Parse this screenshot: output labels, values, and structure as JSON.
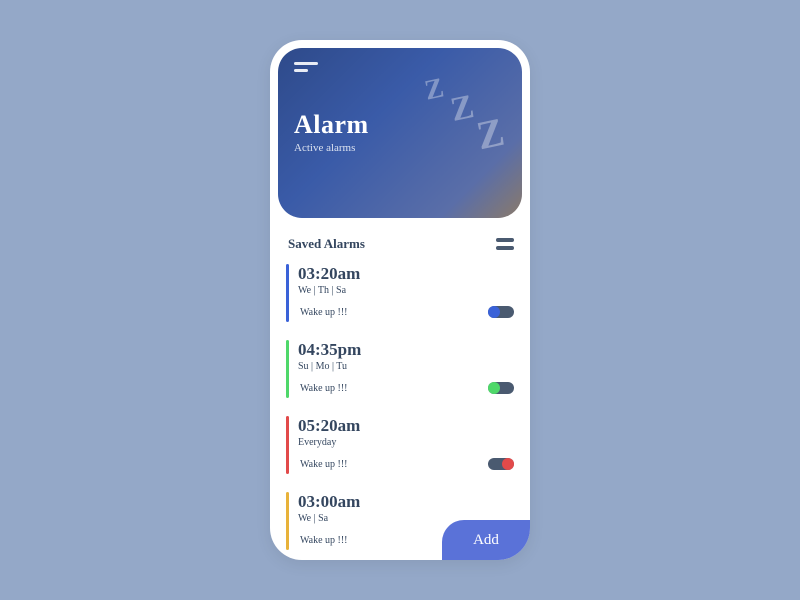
{
  "hero": {
    "title": "Alarm",
    "subtitle": "Active alarms"
  },
  "list": {
    "title": "Saved Alarms"
  },
  "alarms": [
    {
      "time": "03:20am",
      "days": "We | Th | Sa",
      "label": "Wake up !!!",
      "accent": "#3a62d8",
      "on": true
    },
    {
      "time": "04:35pm",
      "days": "Su | Mo | Tu",
      "label": "Wake up !!!",
      "accent": "#4fd86a",
      "on": true
    },
    {
      "time": "05:20am",
      "days": "Everyday",
      "label": "Wake up !!!",
      "accent": "#e24a4a",
      "on": false
    },
    {
      "time": "03:00am",
      "days": "We | Sa",
      "label": "Wake up !!!",
      "accent": "#e8b23a",
      "on": true
    }
  ],
  "add_button": "Add"
}
